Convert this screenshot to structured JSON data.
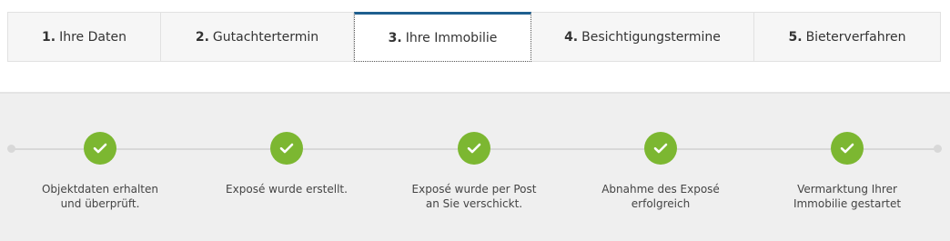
{
  "tabs": [
    {
      "num": "1.",
      "label": "Ihre Daten",
      "active": false
    },
    {
      "num": "2.",
      "label": "Gutachtertermin",
      "active": false
    },
    {
      "num": "3.",
      "label": "Ihre Immobilie",
      "active": true
    },
    {
      "num": "4.",
      "label": "Besichtigungstermine",
      "active": false
    },
    {
      "num": "5.",
      "label": "Bieterverfahren",
      "active": false
    }
  ],
  "progress": {
    "steps": [
      {
        "label": "Objektdaten erhalten\nund überprüft.",
        "done": true
      },
      {
        "label": "Exposé wurde erstellt.",
        "done": true
      },
      {
        "label": "Exposé wurde per Post\nan Sie verschickt.",
        "done": true
      },
      {
        "label": "Abnahme des Exposé\nerfolgreich",
        "done": true
      },
      {
        "label": "Vermarktung Ihrer\nImmobilie gestartet",
        "done": true
      }
    ]
  },
  "colors": {
    "accent": "#1f5f8f",
    "check": "#7cb731",
    "track": "#d8d8d8",
    "panel_bg": "#efefef"
  },
  "icons": {
    "step_status": "check-icon"
  }
}
